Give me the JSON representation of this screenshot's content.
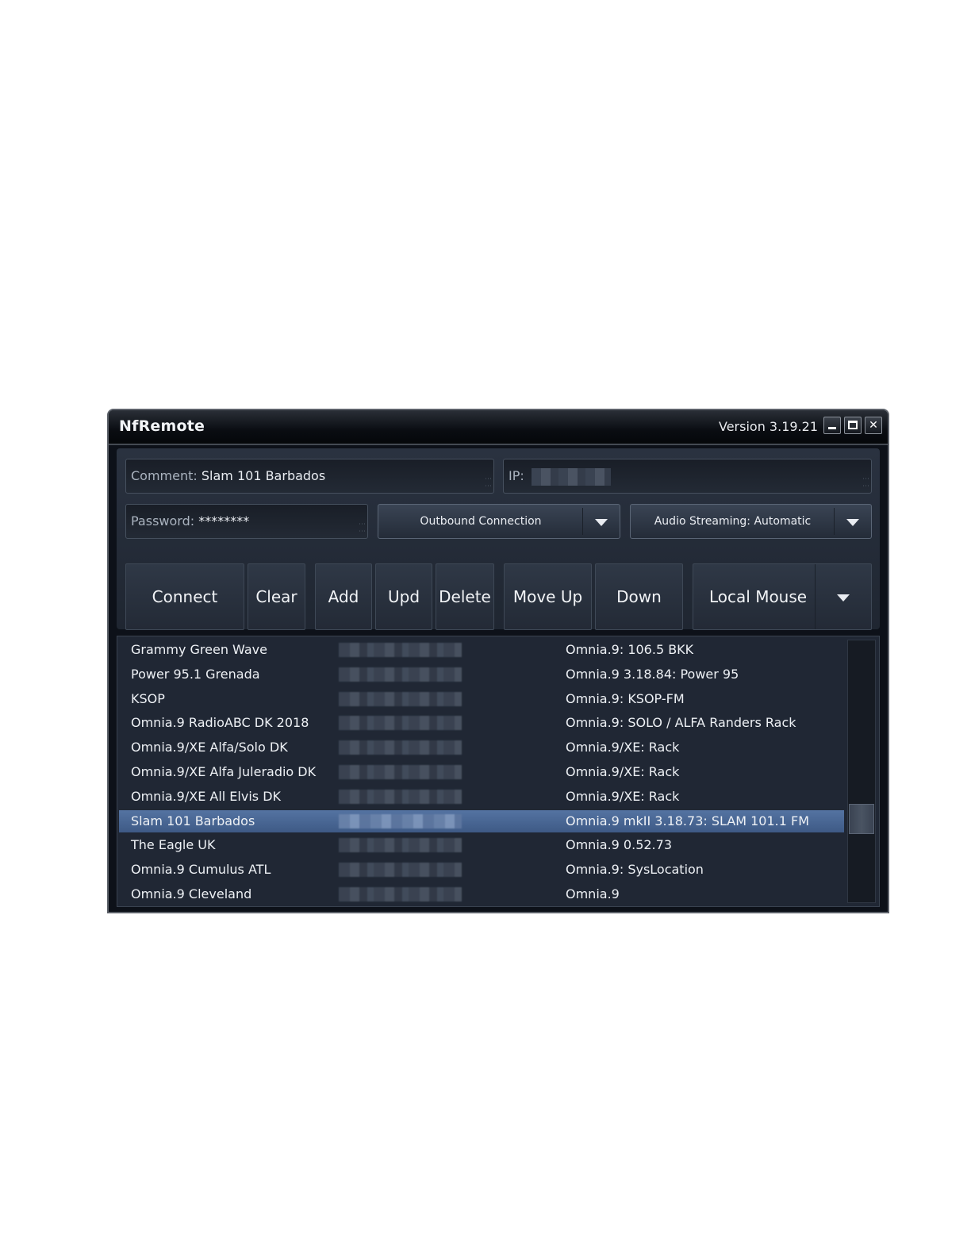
{
  "window": {
    "title": "NfRemote",
    "version": "Version 3.19.21"
  },
  "form": {
    "comment_label": "Comment:",
    "comment_value": "Slam 101 Barbados",
    "ip_label": "IP:",
    "password_label": "Password:",
    "password_value": "********",
    "connection_mode": "Outbound Connection",
    "audio_streaming": "Audio Streaming: Automatic"
  },
  "toolbar": {
    "connect": "Connect",
    "clear": "Clear",
    "add": "Add",
    "upd": "Upd",
    "delete": "Delete",
    "move_up": "Move Up",
    "down": "Down",
    "local_mouse": "Local Mouse"
  },
  "devices": [
    {
      "name": "Grammy Green Wave",
      "device": "Omnia.9: 106.5 BKK"
    },
    {
      "name": "Power 95.1 Grenada",
      "device": "Omnia.9 3.18.84: Power 95"
    },
    {
      "name": "KSOP",
      "device": "Omnia.9: KSOP-FM"
    },
    {
      "name": "Omnia.9 RadioABC DK 2018",
      "device": "Omnia.9: SOLO / ALFA Randers Rack"
    },
    {
      "name": "Omnia.9/XE Alfa/Solo DK",
      "device": "Omnia.9/XE: Rack"
    },
    {
      "name": "Omnia.9/XE Alfa Juleradio DK",
      "device": "Omnia.9/XE: Rack"
    },
    {
      "name": "Omnia.9/XE All Elvis DK",
      "device": "Omnia.9/XE: Rack"
    },
    {
      "name": "Slam 101 Barbados",
      "device": "Omnia.9 mkII 3.18.73: SLAM 101.1 FM"
    },
    {
      "name": "The Eagle UK",
      "device": "Omnia.9 0.52.73"
    },
    {
      "name": "Omnia.9 Cumulus ATL",
      "device": "Omnia.9: SysLocation"
    },
    {
      "name": "Omnia.9 Cleveland",
      "device": "Omnia.9"
    }
  ],
  "selected_index": 7,
  "colors": {
    "selection": "#4a6795",
    "background": "#0d1119"
  }
}
